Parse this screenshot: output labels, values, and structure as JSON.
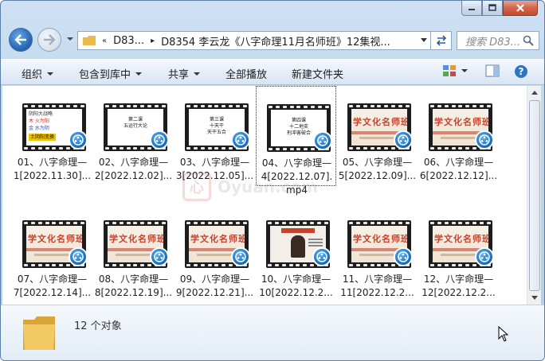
{
  "window": {
    "caption_buttons": [
      "minimize-icon",
      "maximize-icon",
      "close-icon"
    ]
  },
  "nav": {
    "back_icon": "back-arrow-icon",
    "forward_icon": "forward-arrow-icon"
  },
  "address": {
    "overflow": "«",
    "crumbs": [
      "D83...",
      "D8354 李云龙《八字命理11月名师班》12集视..."
    ],
    "refresh_icon": "refresh-icon"
  },
  "search": {
    "placeholder": "搜索 D83..."
  },
  "toolbar": {
    "organize": "组织",
    "include_in_library": "包含到库中",
    "share": "共享",
    "play_all": "全部播放",
    "new_folder": "新建文件夹"
  },
  "files": [
    {
      "line1": "01、八字命理—",
      "line2": "1[2022.11.30]...",
      "thumb": "yinyang"
    },
    {
      "line1": "02、八字命理—",
      "line2": "2[2022.12.02]...",
      "thumb": "slide",
      "slide": [
        "第二课",
        "五运行大论"
      ]
    },
    {
      "line1": "03、八字命理—",
      "line2": "3[2022.12.05]...",
      "thumb": "slide",
      "slide": [
        "第三课",
        "十天干",
        "天干五合"
      ]
    },
    {
      "line1": "04、八字命理—",
      "line2": "4[2022.12.07].",
      "line3": "mp4",
      "thumb": "slide",
      "slide": [
        "第四课",
        "十二地支",
        "刑冲害破合"
      ]
    },
    {
      "line1": "05、八字命理—",
      "line2": "5[2022.12.09]...",
      "thumb": "cover"
    },
    {
      "line1": "06、八字命理—",
      "line2": "6[2022.12.12]...",
      "thumb": "cover"
    },
    {
      "line1": "07、八字命理—",
      "line2": "7[2022.12.14]...",
      "thumb": "cover"
    },
    {
      "line1": "08、八字命理—",
      "line2": "8[2022.12.19]...",
      "thumb": "cover"
    },
    {
      "line1": "09、八字命理—",
      "line2": "9[2022.12.21]...",
      "thumb": "cover"
    },
    {
      "line1": "10、八字命理—",
      "line2": "10[2022.12.2...",
      "thumb": "photo"
    },
    {
      "line1": "11、八字命理—",
      "line2": "11[2022.12.2...",
      "thumb": "cover"
    },
    {
      "line1": "12、八字命理—",
      "line2": "12[2022.12.2...",
      "thumb": "cover"
    }
  ],
  "thumb_text": {
    "cover_title": "学文化名师班",
    "yinyang": [
      "阴阳大战略",
      "木 火为阳",
      "金 水为阴",
      "土阴阳变换"
    ]
  },
  "watermark": {
    "logo": "心",
    "text": "Oyuan.com"
  },
  "details": {
    "count": "12 个对象"
  },
  "colors": {
    "accent": "#1b74c6",
    "chrome": "#bcd4ec",
    "cover_red": "#c6422c"
  }
}
